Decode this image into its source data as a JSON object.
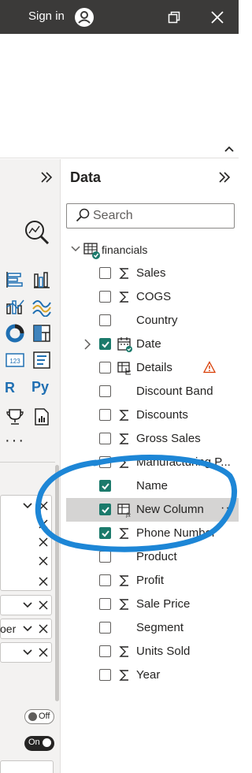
{
  "titlebar": {
    "signin_label": "Sign in",
    "window_controls": [
      "restore-icon",
      "close-icon"
    ]
  },
  "data_pane": {
    "title": "Data",
    "search_placeholder": "Search",
    "table": {
      "name": "financials",
      "fields": [
        {
          "label": "Sales",
          "checked": false,
          "icon": "sigma-icon"
        },
        {
          "label": "COGS",
          "checked": false,
          "icon": "sigma-icon"
        },
        {
          "label": "Country",
          "checked": false,
          "icon": ""
        },
        {
          "label": "Date",
          "checked": true,
          "icon": "calendar-icon",
          "expandable": true
        },
        {
          "label": "Details",
          "checked": false,
          "icon": "table-hierarchy-icon",
          "warning": true
        },
        {
          "label": "Discount Band",
          "checked": false,
          "icon": ""
        },
        {
          "label": "Discounts",
          "checked": false,
          "icon": "sigma-icon"
        },
        {
          "label": "Gross Sales",
          "checked": false,
          "icon": "sigma-icon"
        },
        {
          "label": "Manufacturing P...",
          "checked": false,
          "icon": "sigma-icon"
        },
        {
          "label": "Name",
          "checked": true,
          "icon": ""
        },
        {
          "label": "New Column",
          "checked": true,
          "icon": "calculated-column-icon",
          "selected": true,
          "more": "···"
        },
        {
          "label": "Phone Number",
          "checked": true,
          "icon": "sigma-icon"
        },
        {
          "label": "Product",
          "checked": false,
          "icon": ""
        },
        {
          "label": "Profit",
          "checked": false,
          "icon": "sigma-icon"
        },
        {
          "label": "Sale Price",
          "checked": false,
          "icon": "sigma-icon"
        },
        {
          "label": "Segment",
          "checked": false,
          "icon": ""
        },
        {
          "label": "Units Sold",
          "checked": false,
          "icon": "sigma-icon"
        },
        {
          "label": "Year",
          "checked": false,
          "icon": "sigma-icon"
        }
      ]
    }
  },
  "visualizations": {
    "r_label": "R",
    "py_label": "Py",
    "more_label": "···"
  },
  "field_wells": {
    "partial_text": "oer"
  },
  "toggles": {
    "off_label": "Off",
    "on_label": "On"
  },
  "colors": {
    "titlebar": "#3b3a39",
    "checkbox_checked": "#1b7a6b",
    "annotation_ring": "#1d86d6",
    "warning": "#d83b01"
  }
}
